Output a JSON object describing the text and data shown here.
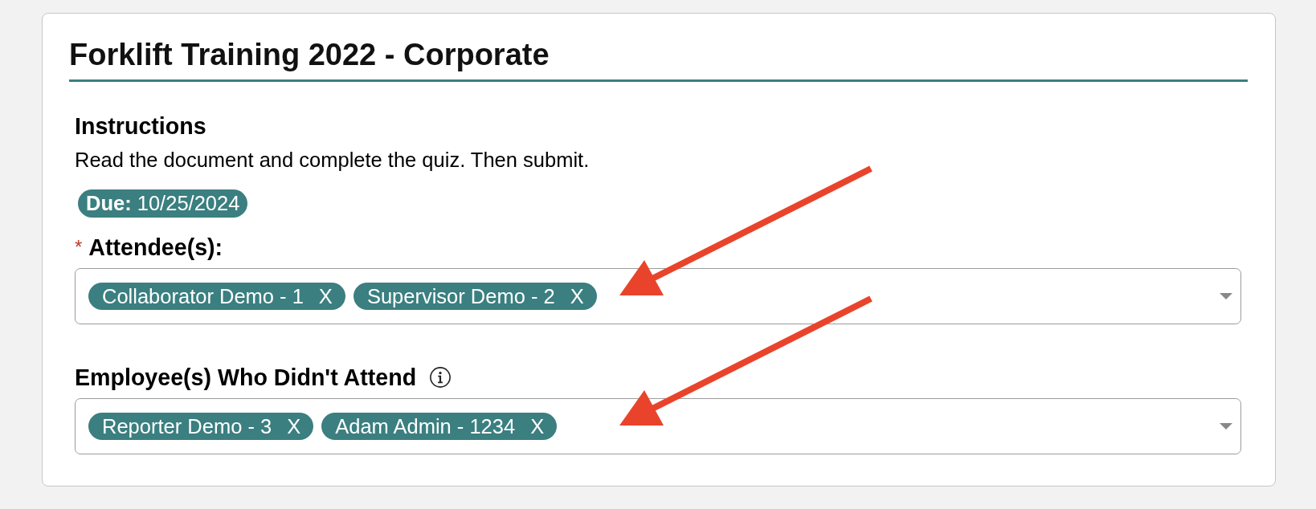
{
  "card": {
    "title": "Forklift Training 2022 - Corporate"
  },
  "instructions": {
    "heading": "Instructions",
    "text": "Read the document and complete the quiz. Then submit."
  },
  "due_badge": "**Due:** 10/25/2024",
  "fields": [
    {
      "label": "Attendee(s):",
      "required_mark": "*",
      "callout_arrow": true,
      "chips": [
        {
          "label": "Collaborator Demo - 1",
          "remove": "X"
        },
        {
          "label": "Supervisor Demo - 2",
          "remove": "X"
        }
      ]
    },
    {
      "label": "Employee(s) Who Didn't Attend",
      "info": true,
      "callout_arrow": true,
      "chips": [
        {
          "label": "Reporter Demo - 3",
          "remove": "X"
        },
        {
          "label": "Adam Admin - 1234",
          "remove": "X"
        }
      ]
    }
  ]
}
